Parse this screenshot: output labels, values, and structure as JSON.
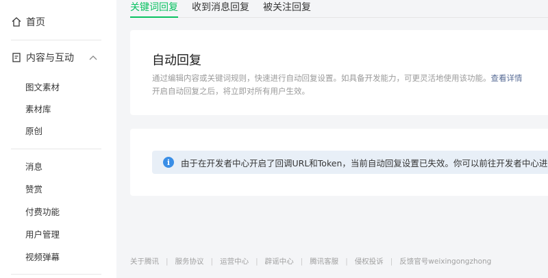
{
  "sidebar": {
    "home": {
      "label": "首页",
      "icon": "home-icon"
    },
    "group": {
      "label": "内容与互动",
      "icon": "document-icon",
      "expand_icon": "chevron-up-icon"
    },
    "group_items": [
      "图文素材",
      "素材库",
      "原创"
    ],
    "items": [
      "消息",
      "赞赏",
      "付费功能",
      "用户管理",
      "视频弹幕"
    ]
  },
  "tabs": [
    {
      "label": "关键词回复",
      "active": true
    },
    {
      "label": "收到消息回复",
      "active": false
    },
    {
      "label": "被关注回复",
      "active": false
    }
  ],
  "auto_reply": {
    "title": "自动回复",
    "desc_line1": "通过编辑内容或关键词规则，快速进行自动回复设置。如具备开发能力，可更灵活地使用该功能。",
    "desc_link": "查看详情",
    "desc_line2": "开启自动回复之后，将立即对所有用户生效。"
  },
  "notice": {
    "icon": "info-icon",
    "icon_glyph": "i",
    "text": "由于在开发者中心开启了回调URL和Token，当前自动回复设置已失效。你可以前往开发者中心进行停用。"
  },
  "footer": {
    "links": [
      "关于腾讯",
      "服务协议",
      "运营中心",
      "辟谣中心",
      "腾讯客服",
      "侵权投诉",
      "反馈官号weixingongzhong"
    ]
  },
  "colors": {
    "accent": "#07c160",
    "link": "#576b95",
    "notice_bg": "#e8eff7",
    "info_icon": "#3a8ee6"
  }
}
